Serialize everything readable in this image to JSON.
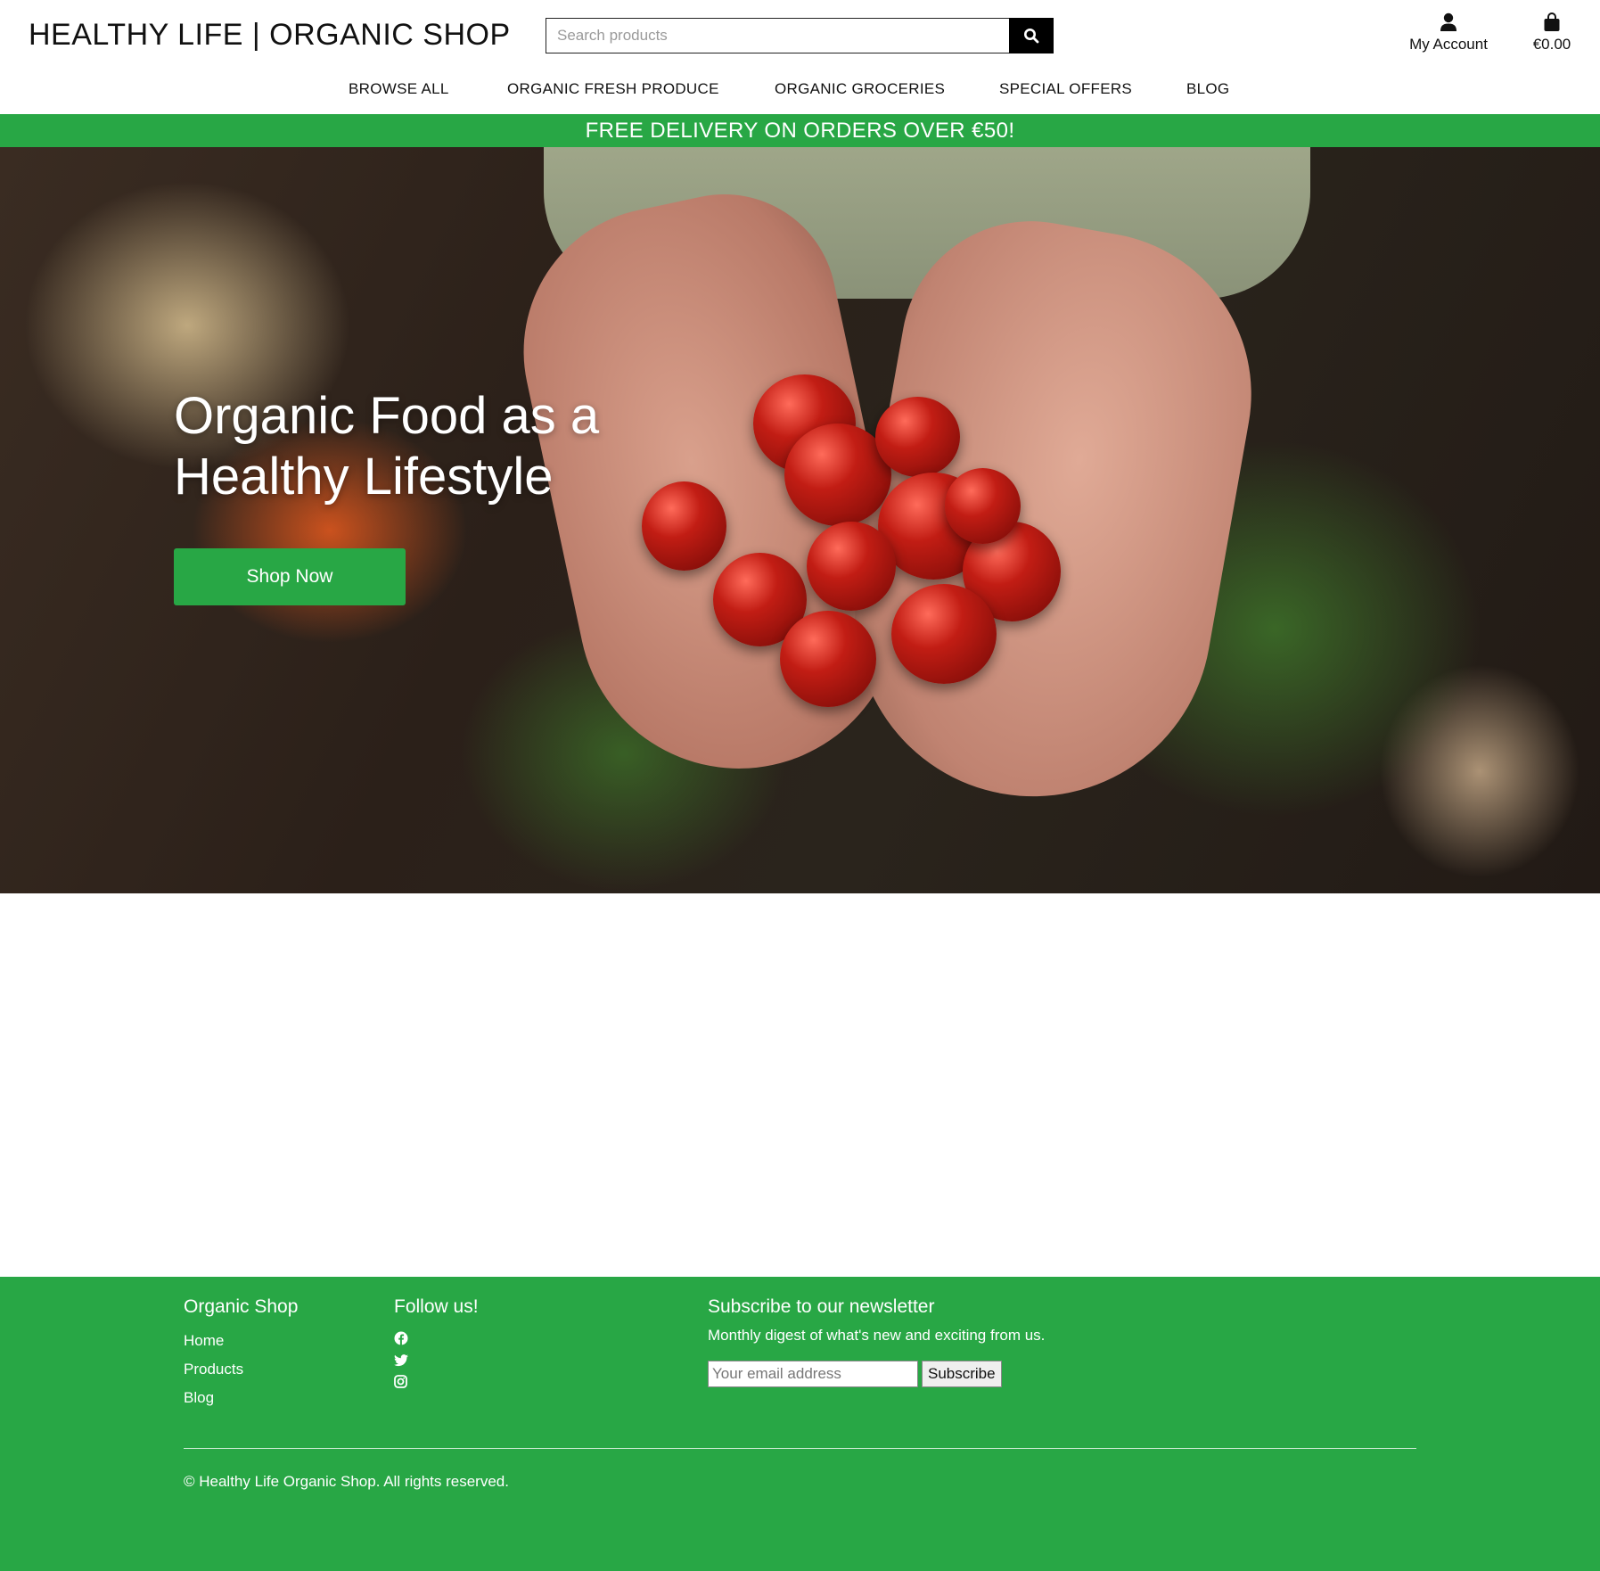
{
  "header": {
    "logo": "HEALTHY LIFE | ORGANIC SHOP",
    "search_placeholder": "Search products",
    "account_label": "My Account",
    "cart_total": "€0.00"
  },
  "nav": {
    "items": [
      "BROWSE ALL",
      "ORGANIC FRESH PRODUCE",
      "ORGANIC GROCERIES",
      "SPECIAL OFFERS",
      "BLOG"
    ]
  },
  "promo": {
    "text": "FREE DELIVERY ON ORDERS OVER €50!"
  },
  "hero": {
    "title_line1": "Organic Food as a",
    "title_line2": "Healthy Lifestyle",
    "button_label": "Shop Now"
  },
  "footer": {
    "shop_heading": "Organic Shop",
    "links": [
      "Home",
      "Products",
      "Blog"
    ],
    "follow_heading": "Follow us!",
    "social_icons": [
      "facebook-icon",
      "twitter-icon",
      "instagram-icon"
    ],
    "newsletter_heading": "Subscribe to our newsletter",
    "newsletter_desc": "Monthly digest of what's new and exciting from us.",
    "email_placeholder": "Your email address",
    "subscribe_label": "Subscribe",
    "copyright": "© Healthy Life Organic Shop. All rights reserved."
  },
  "colors": {
    "brand_green": "#28a745",
    "text_dark": "#111111"
  }
}
